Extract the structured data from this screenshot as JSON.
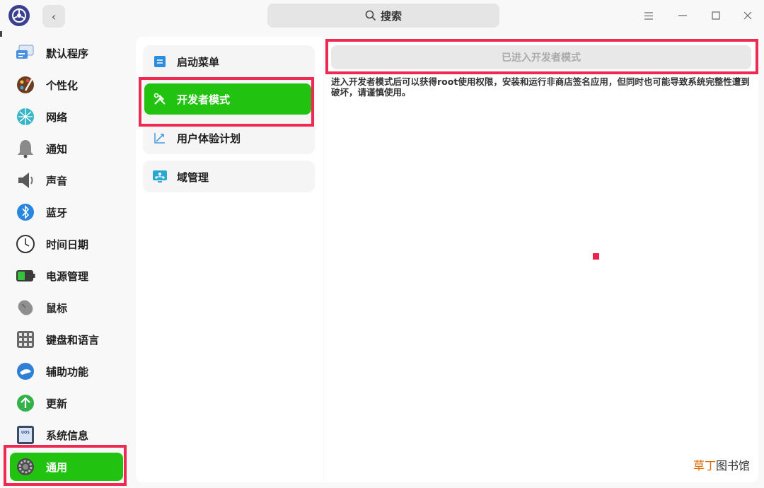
{
  "search": {
    "label": "搜索"
  },
  "nav": {
    "items": [
      {
        "label": "默认程序",
        "icon": "default-apps-icon"
      },
      {
        "label": "个性化",
        "icon": "personalization-icon"
      },
      {
        "label": "网络",
        "icon": "network-icon"
      },
      {
        "label": "通知",
        "icon": "notification-bell-icon"
      },
      {
        "label": "声音",
        "icon": "speaker-icon"
      },
      {
        "label": "蓝牙",
        "icon": "bluetooth-icon"
      },
      {
        "label": "时间日期",
        "icon": "clock-icon"
      },
      {
        "label": "电源管理",
        "icon": "battery-icon"
      },
      {
        "label": "鼠标",
        "icon": "mouse-icon"
      },
      {
        "label": "键盘和语言",
        "icon": "keyboard-icon"
      },
      {
        "label": "辅助功能",
        "icon": "accessibility-icon"
      },
      {
        "label": "更新",
        "icon": "update-arrow-icon"
      },
      {
        "label": "系统信息",
        "icon": "system-info-icon"
      },
      {
        "label": "通用",
        "icon": "gear-icon"
      }
    ],
    "active_index": 13
  },
  "general": {
    "items": [
      {
        "label": "启动菜单",
        "icon": "boot-menu-icon"
      },
      {
        "label": "开发者模式",
        "icon": "developer-tools-icon"
      },
      {
        "label": "用户体验计划",
        "icon": "user-experience-icon"
      },
      {
        "label": "域管理",
        "icon": "domain-management-icon"
      }
    ],
    "active_index": 1
  },
  "developer": {
    "button_label": "已进入开发者模式",
    "description": "进入开发者模式后可以获得root使用权限，安装和运行非商店签名应用，但同时也可能导致系统完整性遭到破坏，请谨慎使用。"
  },
  "watermark": {
    "part1": "草丁",
    "part2": "图书馆"
  },
  "colors": {
    "accent_green": "#22c310",
    "highlight_red": "#ee2a52"
  }
}
